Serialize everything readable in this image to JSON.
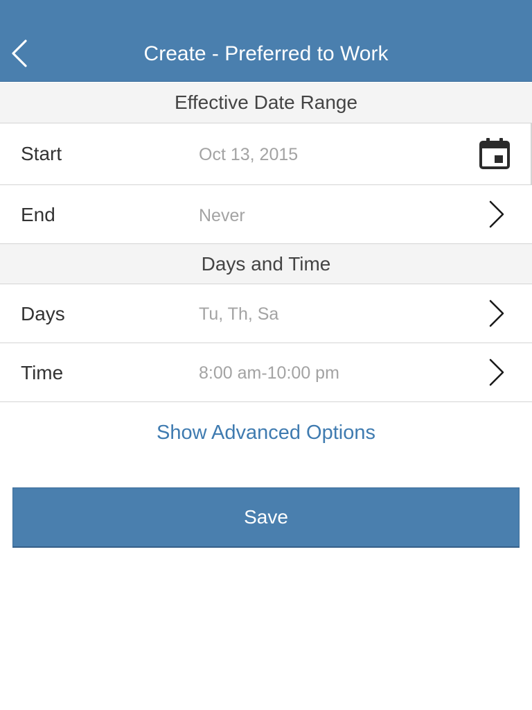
{
  "header": {
    "title": "Create - Preferred to Work",
    "back_icon": "chevron-left-icon"
  },
  "sections": {
    "date_range": "Effective Date Range",
    "days_time": "Days and Time"
  },
  "rows": {
    "start": {
      "label": "Start",
      "value": "Oct 13, 2015",
      "icon": "calendar-icon"
    },
    "end": {
      "label": "End",
      "value": "Never",
      "icon": "chevron-right-icon"
    },
    "days": {
      "label": "Days",
      "value": "Tu, Th, Sa",
      "icon": "chevron-right-icon"
    },
    "time": {
      "label": "Time",
      "value": "8:00 am-10:00 pm",
      "icon": "chevron-right-icon"
    }
  },
  "advanced_link": "Show Advanced Options",
  "save_label": "Save",
  "colors": {
    "header_bg": "#4a7fae",
    "link": "#3f7bb0",
    "section_bg": "#f4f4f4"
  }
}
